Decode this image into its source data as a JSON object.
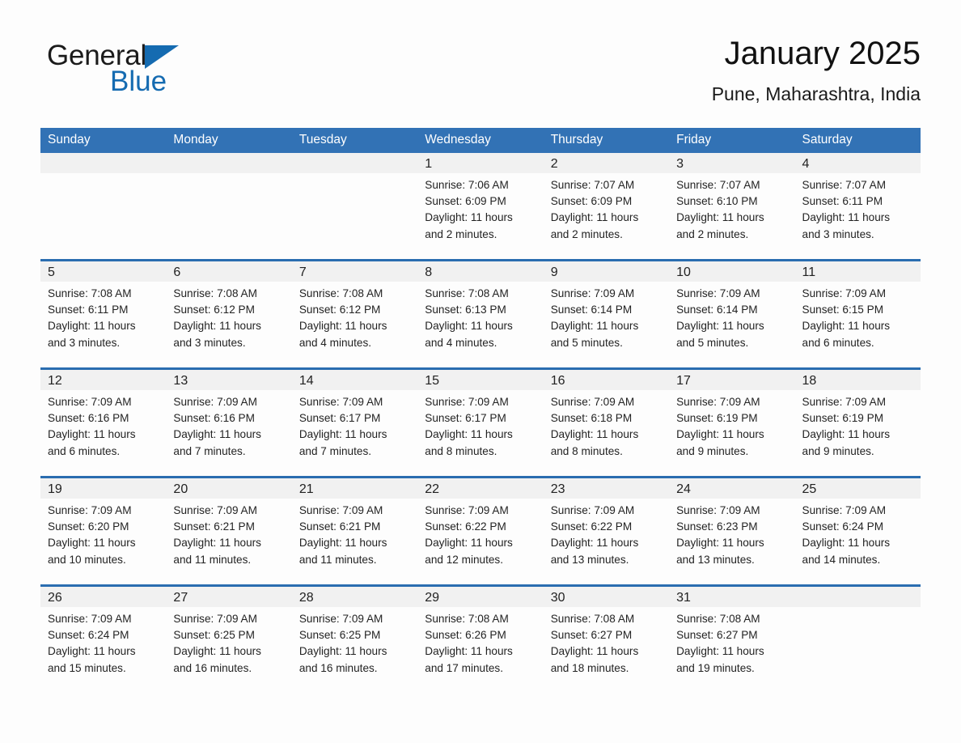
{
  "brand": {
    "name_part1": "General",
    "name_part2": "Blue",
    "logo_icon": "triangle-logo-icon",
    "accent_color": "#156bb1"
  },
  "header": {
    "title": "January 2025",
    "location": "Pune, Maharashtra, India"
  },
  "theme": {
    "header_blue": "#3272b5",
    "row_rule_blue": "#2a6db0",
    "daynum_band": "#f1f1f1",
    "page_background": "#fdfdfd"
  },
  "weekday_headers": [
    "Sunday",
    "Monday",
    "Tuesday",
    "Wednesday",
    "Thursday",
    "Friday",
    "Saturday"
  ],
  "weeks": [
    [
      {
        "day": "",
        "empty": true
      },
      {
        "day": "",
        "empty": true
      },
      {
        "day": "",
        "empty": true
      },
      {
        "day": "1",
        "sunrise": "Sunrise: 7:06 AM",
        "sunset": "Sunset: 6:09 PM",
        "daylight_1": "Daylight: 11 hours",
        "daylight_2": "and 2 minutes."
      },
      {
        "day": "2",
        "sunrise": "Sunrise: 7:07 AM",
        "sunset": "Sunset: 6:09 PM",
        "daylight_1": "Daylight: 11 hours",
        "daylight_2": "and 2 minutes."
      },
      {
        "day": "3",
        "sunrise": "Sunrise: 7:07 AM",
        "sunset": "Sunset: 6:10 PM",
        "daylight_1": "Daylight: 11 hours",
        "daylight_2": "and 2 minutes."
      },
      {
        "day": "4",
        "sunrise": "Sunrise: 7:07 AM",
        "sunset": "Sunset: 6:11 PM",
        "daylight_1": "Daylight: 11 hours",
        "daylight_2": "and 3 minutes."
      }
    ],
    [
      {
        "day": "5",
        "sunrise": "Sunrise: 7:08 AM",
        "sunset": "Sunset: 6:11 PM",
        "daylight_1": "Daylight: 11 hours",
        "daylight_2": "and 3 minutes."
      },
      {
        "day": "6",
        "sunrise": "Sunrise: 7:08 AM",
        "sunset": "Sunset: 6:12 PM",
        "daylight_1": "Daylight: 11 hours",
        "daylight_2": "and 3 minutes."
      },
      {
        "day": "7",
        "sunrise": "Sunrise: 7:08 AM",
        "sunset": "Sunset: 6:12 PM",
        "daylight_1": "Daylight: 11 hours",
        "daylight_2": "and 4 minutes."
      },
      {
        "day": "8",
        "sunrise": "Sunrise: 7:08 AM",
        "sunset": "Sunset: 6:13 PM",
        "daylight_1": "Daylight: 11 hours",
        "daylight_2": "and 4 minutes."
      },
      {
        "day": "9",
        "sunrise": "Sunrise: 7:09 AM",
        "sunset": "Sunset: 6:14 PM",
        "daylight_1": "Daylight: 11 hours",
        "daylight_2": "and 5 minutes."
      },
      {
        "day": "10",
        "sunrise": "Sunrise: 7:09 AM",
        "sunset": "Sunset: 6:14 PM",
        "daylight_1": "Daylight: 11 hours",
        "daylight_2": "and 5 minutes."
      },
      {
        "day": "11",
        "sunrise": "Sunrise: 7:09 AM",
        "sunset": "Sunset: 6:15 PM",
        "daylight_1": "Daylight: 11 hours",
        "daylight_2": "and 6 minutes."
      }
    ],
    [
      {
        "day": "12",
        "sunrise": "Sunrise: 7:09 AM",
        "sunset": "Sunset: 6:16 PM",
        "daylight_1": "Daylight: 11 hours",
        "daylight_2": "and 6 minutes."
      },
      {
        "day": "13",
        "sunrise": "Sunrise: 7:09 AM",
        "sunset": "Sunset: 6:16 PM",
        "daylight_1": "Daylight: 11 hours",
        "daylight_2": "and 7 minutes."
      },
      {
        "day": "14",
        "sunrise": "Sunrise: 7:09 AM",
        "sunset": "Sunset: 6:17 PM",
        "daylight_1": "Daylight: 11 hours",
        "daylight_2": "and 7 minutes."
      },
      {
        "day": "15",
        "sunrise": "Sunrise: 7:09 AM",
        "sunset": "Sunset: 6:17 PM",
        "daylight_1": "Daylight: 11 hours",
        "daylight_2": "and 8 minutes."
      },
      {
        "day": "16",
        "sunrise": "Sunrise: 7:09 AM",
        "sunset": "Sunset: 6:18 PM",
        "daylight_1": "Daylight: 11 hours",
        "daylight_2": "and 8 minutes."
      },
      {
        "day": "17",
        "sunrise": "Sunrise: 7:09 AM",
        "sunset": "Sunset: 6:19 PM",
        "daylight_1": "Daylight: 11 hours",
        "daylight_2": "and 9 minutes."
      },
      {
        "day": "18",
        "sunrise": "Sunrise: 7:09 AM",
        "sunset": "Sunset: 6:19 PM",
        "daylight_1": "Daylight: 11 hours",
        "daylight_2": "and 9 minutes."
      }
    ],
    [
      {
        "day": "19",
        "sunrise": "Sunrise: 7:09 AM",
        "sunset": "Sunset: 6:20 PM",
        "daylight_1": "Daylight: 11 hours",
        "daylight_2": "and 10 minutes."
      },
      {
        "day": "20",
        "sunrise": "Sunrise: 7:09 AM",
        "sunset": "Sunset: 6:21 PM",
        "daylight_1": "Daylight: 11 hours",
        "daylight_2": "and 11 minutes."
      },
      {
        "day": "21",
        "sunrise": "Sunrise: 7:09 AM",
        "sunset": "Sunset: 6:21 PM",
        "daylight_1": "Daylight: 11 hours",
        "daylight_2": "and 11 minutes."
      },
      {
        "day": "22",
        "sunrise": "Sunrise: 7:09 AM",
        "sunset": "Sunset: 6:22 PM",
        "daylight_1": "Daylight: 11 hours",
        "daylight_2": "and 12 minutes."
      },
      {
        "day": "23",
        "sunrise": "Sunrise: 7:09 AM",
        "sunset": "Sunset: 6:22 PM",
        "daylight_1": "Daylight: 11 hours",
        "daylight_2": "and 13 minutes."
      },
      {
        "day": "24",
        "sunrise": "Sunrise: 7:09 AM",
        "sunset": "Sunset: 6:23 PM",
        "daylight_1": "Daylight: 11 hours",
        "daylight_2": "and 13 minutes."
      },
      {
        "day": "25",
        "sunrise": "Sunrise: 7:09 AM",
        "sunset": "Sunset: 6:24 PM",
        "daylight_1": "Daylight: 11 hours",
        "daylight_2": "and 14 minutes."
      }
    ],
    [
      {
        "day": "26",
        "sunrise": "Sunrise: 7:09 AM",
        "sunset": "Sunset: 6:24 PM",
        "daylight_1": "Daylight: 11 hours",
        "daylight_2": "and 15 minutes."
      },
      {
        "day": "27",
        "sunrise": "Sunrise: 7:09 AM",
        "sunset": "Sunset: 6:25 PM",
        "daylight_1": "Daylight: 11 hours",
        "daylight_2": "and 16 minutes."
      },
      {
        "day": "28",
        "sunrise": "Sunrise: 7:09 AM",
        "sunset": "Sunset: 6:25 PM",
        "daylight_1": "Daylight: 11 hours",
        "daylight_2": "and 16 minutes."
      },
      {
        "day": "29",
        "sunrise": "Sunrise: 7:08 AM",
        "sunset": "Sunset: 6:26 PM",
        "daylight_1": "Daylight: 11 hours",
        "daylight_2": "and 17 minutes."
      },
      {
        "day": "30",
        "sunrise": "Sunrise: 7:08 AM",
        "sunset": "Sunset: 6:27 PM",
        "daylight_1": "Daylight: 11 hours",
        "daylight_2": "and 18 minutes."
      },
      {
        "day": "31",
        "sunrise": "Sunrise: 7:08 AM",
        "sunset": "Sunset: 6:27 PM",
        "daylight_1": "Daylight: 11 hours",
        "daylight_2": "and 19 minutes."
      },
      {
        "day": "",
        "empty": true
      }
    ]
  ]
}
